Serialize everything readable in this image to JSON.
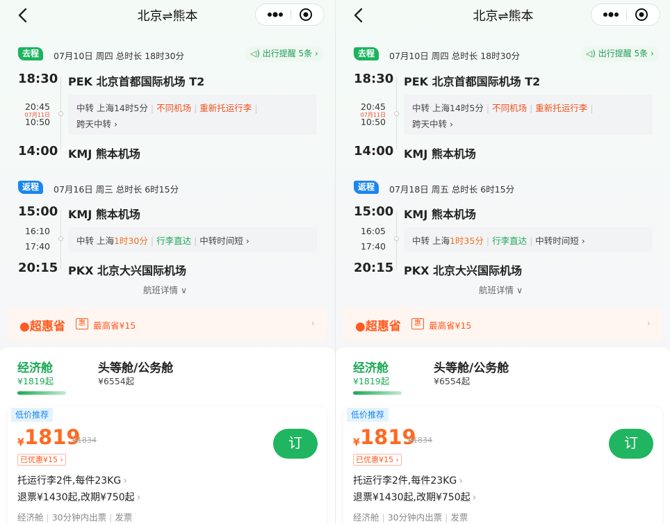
{
  "panels": [
    {
      "nav": {
        "title": "北京⇌熊本"
      },
      "outbound": {
        "tag": "去程",
        "info": "07月10日 周四   总时长 18时30分",
        "reminder": "出行提醒 5条 ›",
        "dep_time": "18:30",
        "dep_airport": "PEK 北京首都国际机场 T2",
        "arr1": "20:45",
        "nextday": "07月11日",
        "dep2": "10:50",
        "transfer": {
          "city": "中转 上海",
          "duration": "14时5分",
          "t1": "不同机场",
          "t2": "重新托运行李",
          "line2": "跨天中转 ›"
        },
        "arr_time": "14:00",
        "arr_airport": "KMJ 熊本机场"
      },
      "return": {
        "tag": "返程",
        "info": "07月16日 周三   总时长 6时15分",
        "dep_time": "15:00",
        "dep_airport": "KMJ 熊本机场",
        "arr1": "16:10",
        "dep2": "17:40",
        "transfer": {
          "city": "中转 上海",
          "duration": "1时30分",
          "t1": "行李直达",
          "t2": "中转时间短 ›"
        },
        "arr_time": "20:15",
        "arr_airport": "PKX 北京大兴国际机场",
        "details": "航班详情 ∨"
      },
      "savings": {
        "logo": "超惠省",
        "badge": "惠",
        "text": "最高省¥15",
        "arrow": "›"
      },
      "cabins": [
        {
          "name": "经济舱",
          "price": "¥1819起"
        },
        {
          "name": "头等舱/公务舱",
          "price": "¥6554起"
        }
      ],
      "offer": {
        "tag": "低价推荐",
        "currency": "¥",
        "price": "1819",
        "old_price": "¥1834",
        "discount": "已优惠¥15 ›",
        "book": "订",
        "baggage": "托运行李2件,每件23KG",
        "refund": "退票¥1430起,改期¥750起",
        "meta": [
          "经济舱",
          "30分钟内出票",
          "发票"
        ]
      }
    },
    {
      "nav": {
        "title": "北京⇌熊本"
      },
      "outbound": {
        "tag": "去程",
        "info": "07月10日 周四   总时长 18时30分",
        "reminder": "出行提醒 5条 ›",
        "dep_time": "18:30",
        "dep_airport": "PEK 北京首都国际机场 T2",
        "arr1": "20:45",
        "nextday": "07月11日",
        "dep2": "10:50",
        "transfer": {
          "city": "中转 上海",
          "duration": "14时5分",
          "t1": "不同机场",
          "t2": "重新托运行李",
          "line2": "跨天中转 ›"
        },
        "arr_time": "14:00",
        "arr_airport": "KMJ 熊本机场"
      },
      "return": {
        "tag": "返程",
        "info": "07月18日 周五   总时长 6时15分",
        "dep_time": "15:00",
        "dep_airport": "KMJ 熊本机场",
        "arr1": "16:05",
        "dep2": "17:40",
        "transfer": {
          "city": "中转 上海",
          "duration": "1时35分",
          "t1": "行李直达",
          "t2": "中转时间短 ›"
        },
        "arr_time": "20:15",
        "arr_airport": "PKX 北京大兴国际机场",
        "details": "航班详情 ∨"
      },
      "savings": {
        "logo": "超惠省",
        "badge": "惠",
        "text": "最高省¥15",
        "arrow": "›"
      },
      "cabins": [
        {
          "name": "经济舱",
          "price": "¥1819起"
        },
        {
          "name": "头等舱/公务舱",
          "price": "¥6554起"
        }
      ],
      "offer": {
        "tag": "低价推荐",
        "currency": "¥",
        "price": "1819",
        "old_price": "¥1834",
        "discount": "已优惠¥15 ›",
        "book": "订",
        "baggage": "托运行李2件,每件23KG",
        "refund": "退票¥1430起,改期¥750起",
        "meta": [
          "经济舱",
          "30分钟内出票",
          "发票"
        ]
      }
    }
  ]
}
